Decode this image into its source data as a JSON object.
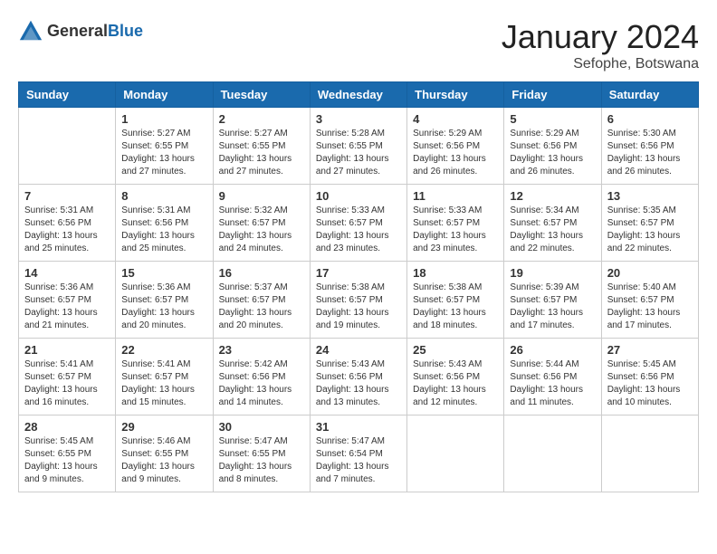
{
  "header": {
    "logo_general": "General",
    "logo_blue": "Blue",
    "month_title": "January 2024",
    "location": "Sefophe, Botswana"
  },
  "weekdays": [
    "Sunday",
    "Monday",
    "Tuesday",
    "Wednesday",
    "Thursday",
    "Friday",
    "Saturday"
  ],
  "weeks": [
    [
      {
        "day": "",
        "info": ""
      },
      {
        "day": "1",
        "info": "Sunrise: 5:27 AM\nSunset: 6:55 PM\nDaylight: 13 hours\nand 27 minutes."
      },
      {
        "day": "2",
        "info": "Sunrise: 5:27 AM\nSunset: 6:55 PM\nDaylight: 13 hours\nand 27 minutes."
      },
      {
        "day": "3",
        "info": "Sunrise: 5:28 AM\nSunset: 6:55 PM\nDaylight: 13 hours\nand 27 minutes."
      },
      {
        "day": "4",
        "info": "Sunrise: 5:29 AM\nSunset: 6:56 PM\nDaylight: 13 hours\nand 26 minutes."
      },
      {
        "day": "5",
        "info": "Sunrise: 5:29 AM\nSunset: 6:56 PM\nDaylight: 13 hours\nand 26 minutes."
      },
      {
        "day": "6",
        "info": "Sunrise: 5:30 AM\nSunset: 6:56 PM\nDaylight: 13 hours\nand 26 minutes."
      }
    ],
    [
      {
        "day": "7",
        "info": "Sunrise: 5:31 AM\nSunset: 6:56 PM\nDaylight: 13 hours\nand 25 minutes."
      },
      {
        "day": "8",
        "info": "Sunrise: 5:31 AM\nSunset: 6:56 PM\nDaylight: 13 hours\nand 25 minutes."
      },
      {
        "day": "9",
        "info": "Sunrise: 5:32 AM\nSunset: 6:57 PM\nDaylight: 13 hours\nand 24 minutes."
      },
      {
        "day": "10",
        "info": "Sunrise: 5:33 AM\nSunset: 6:57 PM\nDaylight: 13 hours\nand 23 minutes."
      },
      {
        "day": "11",
        "info": "Sunrise: 5:33 AM\nSunset: 6:57 PM\nDaylight: 13 hours\nand 23 minutes."
      },
      {
        "day": "12",
        "info": "Sunrise: 5:34 AM\nSunset: 6:57 PM\nDaylight: 13 hours\nand 22 minutes."
      },
      {
        "day": "13",
        "info": "Sunrise: 5:35 AM\nSunset: 6:57 PM\nDaylight: 13 hours\nand 22 minutes."
      }
    ],
    [
      {
        "day": "14",
        "info": "Sunrise: 5:36 AM\nSunset: 6:57 PM\nDaylight: 13 hours\nand 21 minutes."
      },
      {
        "day": "15",
        "info": "Sunrise: 5:36 AM\nSunset: 6:57 PM\nDaylight: 13 hours\nand 20 minutes."
      },
      {
        "day": "16",
        "info": "Sunrise: 5:37 AM\nSunset: 6:57 PM\nDaylight: 13 hours\nand 20 minutes."
      },
      {
        "day": "17",
        "info": "Sunrise: 5:38 AM\nSunset: 6:57 PM\nDaylight: 13 hours\nand 19 minutes."
      },
      {
        "day": "18",
        "info": "Sunrise: 5:38 AM\nSunset: 6:57 PM\nDaylight: 13 hours\nand 18 minutes."
      },
      {
        "day": "19",
        "info": "Sunrise: 5:39 AM\nSunset: 6:57 PM\nDaylight: 13 hours\nand 17 minutes."
      },
      {
        "day": "20",
        "info": "Sunrise: 5:40 AM\nSunset: 6:57 PM\nDaylight: 13 hours\nand 17 minutes."
      }
    ],
    [
      {
        "day": "21",
        "info": "Sunrise: 5:41 AM\nSunset: 6:57 PM\nDaylight: 13 hours\nand 16 minutes."
      },
      {
        "day": "22",
        "info": "Sunrise: 5:41 AM\nSunset: 6:57 PM\nDaylight: 13 hours\nand 15 minutes."
      },
      {
        "day": "23",
        "info": "Sunrise: 5:42 AM\nSunset: 6:56 PM\nDaylight: 13 hours\nand 14 minutes."
      },
      {
        "day": "24",
        "info": "Sunrise: 5:43 AM\nSunset: 6:56 PM\nDaylight: 13 hours\nand 13 minutes."
      },
      {
        "day": "25",
        "info": "Sunrise: 5:43 AM\nSunset: 6:56 PM\nDaylight: 13 hours\nand 12 minutes."
      },
      {
        "day": "26",
        "info": "Sunrise: 5:44 AM\nSunset: 6:56 PM\nDaylight: 13 hours\nand 11 minutes."
      },
      {
        "day": "27",
        "info": "Sunrise: 5:45 AM\nSunset: 6:56 PM\nDaylight: 13 hours\nand 10 minutes."
      }
    ],
    [
      {
        "day": "28",
        "info": "Sunrise: 5:45 AM\nSunset: 6:55 PM\nDaylight: 13 hours\nand 9 minutes."
      },
      {
        "day": "29",
        "info": "Sunrise: 5:46 AM\nSunset: 6:55 PM\nDaylight: 13 hours\nand 9 minutes."
      },
      {
        "day": "30",
        "info": "Sunrise: 5:47 AM\nSunset: 6:55 PM\nDaylight: 13 hours\nand 8 minutes."
      },
      {
        "day": "31",
        "info": "Sunrise: 5:47 AM\nSunset: 6:54 PM\nDaylight: 13 hours\nand 7 minutes."
      },
      {
        "day": "",
        "info": ""
      },
      {
        "day": "",
        "info": ""
      },
      {
        "day": "",
        "info": ""
      }
    ]
  ]
}
